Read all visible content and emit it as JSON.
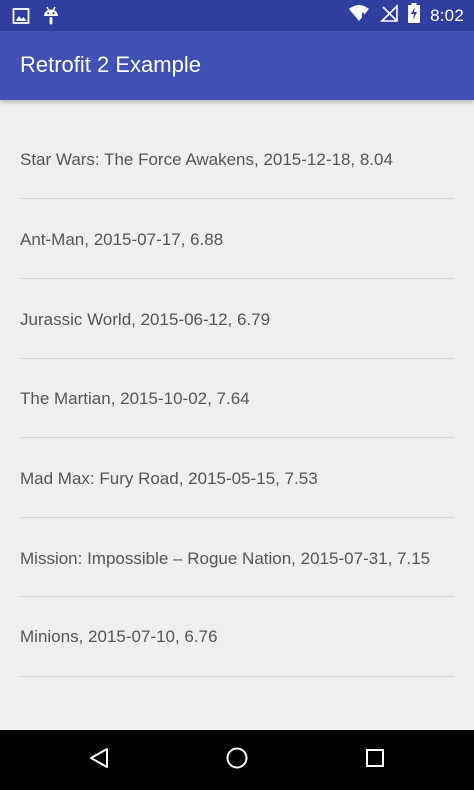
{
  "status_bar": {
    "time": "8:02",
    "icons": [
      "image-icon",
      "android-icon",
      "wifi-icon",
      "no-signal-icon",
      "battery-charging-icon"
    ]
  },
  "app_bar": {
    "title": "Retrofit 2 Example"
  },
  "movies": [
    "Star Wars: The Force Awakens, 2015-12-18, 8.04",
    "Ant-Man, 2015-07-17, 6.88",
    "Jurassic World, 2015-06-12, 6.79",
    "The Martian, 2015-10-02, 7.64",
    "Mad Max: Fury Road, 2015-05-15, 7.53",
    "Mission: Impossible – Rogue Nation, 2015-07-31, 7.15",
    "Minions, 2015-07-10, 6.76"
  ],
  "nav_bar": {
    "buttons": [
      "back-icon",
      "home-icon",
      "recents-icon"
    ]
  },
  "colors": {
    "primary": "#3F51B5",
    "primary_dark": "#303F9F",
    "background": "#EFEFEF",
    "text": "#555555"
  }
}
